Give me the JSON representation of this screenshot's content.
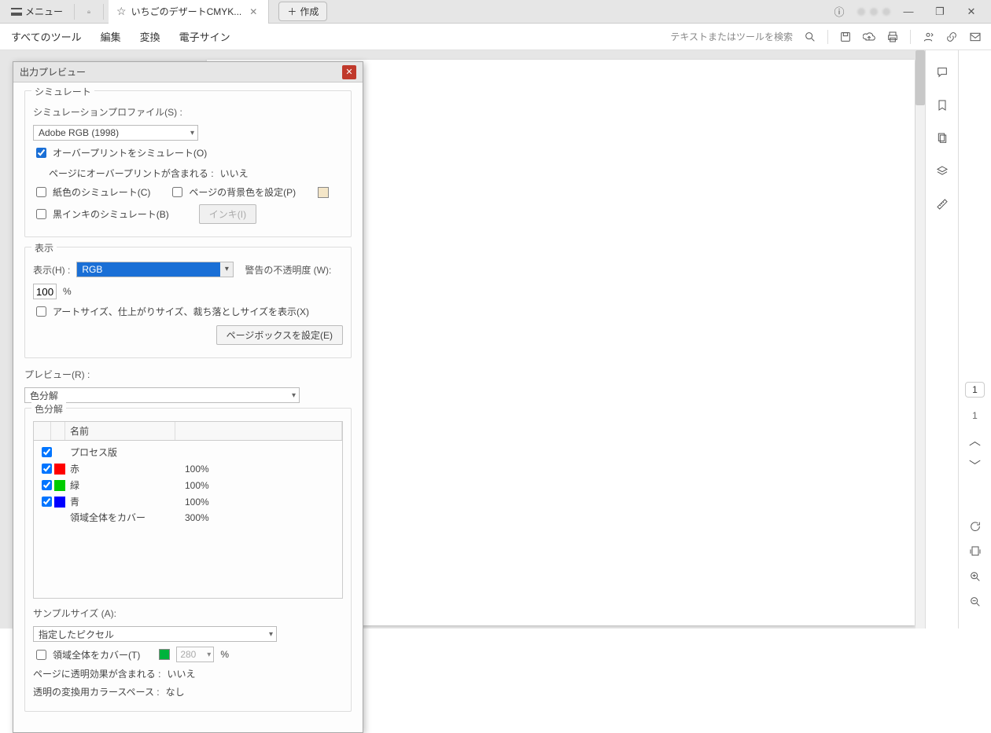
{
  "titlebar": {
    "menu_label": "メニュー",
    "tab_title": "いちごのデザートCMYK...",
    "create_label": "作成"
  },
  "toolbar": {
    "all_tools": "すべてのツール",
    "edit": "編集",
    "convert": "変換",
    "esign": "電子サイン",
    "search_placeholder": "テキストまたはツールを検索"
  },
  "right": {
    "page_current": "1",
    "page_total": "1"
  },
  "dialog": {
    "title": "出力プレビュー",
    "simulate": {
      "legend": "シミュレート",
      "profile_label": "シミュレーションプロファイル(S) :",
      "profile_value": "Adobe RGB (1998)",
      "overprint_cb": "オーバープリントをシミュレート(O)",
      "overprint_contains": "ページにオーバープリントが含まれる :",
      "overprint_contains_value": "いいえ",
      "paper_cb": "紙色のシミュレート(C)",
      "pagebg_cb": "ページの背景色を設定(P)",
      "blackink_cb": "黒インキのシミュレート(B)",
      "ink_btn": "インキ(I)"
    },
    "display": {
      "legend": "表示",
      "show_label": "表示(H) :",
      "show_value": "RGB",
      "warn_label": "警告の不透明度 (W):",
      "warn_value": "100",
      "pct": "%",
      "artsize_cb": "アートサイズ、仕上がりサイズ、裁ち落としサイズを表示(X)",
      "pagebox_btn": "ページボックスを設定(E)"
    },
    "preview": {
      "label": "プレビュー(R) :",
      "value": "色分解"
    },
    "separations": {
      "legend": "色分解",
      "col_name": "名前",
      "rows": [
        {
          "name": "プロセス版",
          "pct": ""
        },
        {
          "name": "赤",
          "pct": "100%",
          "color": "color-red"
        },
        {
          "name": "緑",
          "pct": "100%",
          "color": "color-green"
        },
        {
          "name": "青",
          "pct": "100%",
          "color": "color-blue"
        },
        {
          "name": "領域全体をカバー",
          "pct": "300%"
        }
      ],
      "sample_label": "サンプルサイズ (A):",
      "sample_value": "指定したピクセル",
      "total_cb": "領域全体をカバー(T)",
      "total_value": "280",
      "transparency_contains": "ページに透明効果が含まれる :",
      "transparency_value": "いいえ",
      "blend_space": "透明の変換用カラースペース :",
      "blend_value": "なし"
    }
  }
}
